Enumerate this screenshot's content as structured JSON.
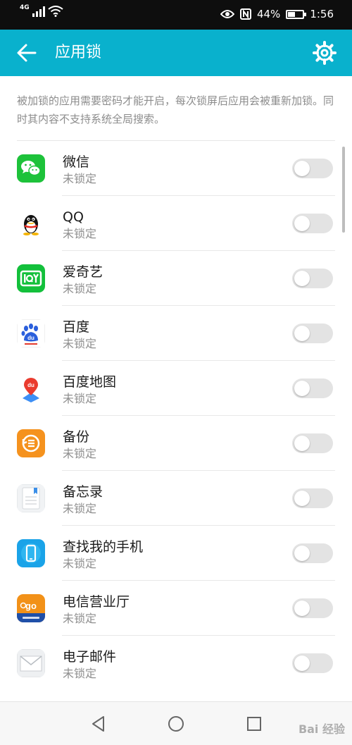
{
  "status_bar": {
    "network": "4G",
    "battery_percent": "44%",
    "time": "1:56",
    "icons": [
      "signal-icon",
      "wifi-icon",
      "eye-icon",
      "nfc-icon",
      "battery-icon"
    ]
  },
  "header": {
    "title": "应用锁",
    "back_icon": "arrow-left-icon",
    "settings_icon": "gear-icon"
  },
  "description": "被加锁的应用需要密码才能开启，每次锁屏后应用会被重新加锁。同时其内容不支持系统全局搜索。",
  "apps": [
    {
      "name": "微信",
      "status": "未锁定",
      "icon": "wechat-icon",
      "locked": false
    },
    {
      "name": "QQ",
      "status": "未锁定",
      "icon": "qq-icon",
      "locked": false
    },
    {
      "name": "爱奇艺",
      "status": "未锁定",
      "icon": "iqiyi-icon",
      "locked": false
    },
    {
      "name": "百度",
      "status": "未锁定",
      "icon": "baidu-icon",
      "locked": false
    },
    {
      "name": "百度地图",
      "status": "未锁定",
      "icon": "baidu-map-icon",
      "locked": false
    },
    {
      "name": "备份",
      "status": "未锁定",
      "icon": "backup-icon",
      "locked": false
    },
    {
      "name": "备忘录",
      "status": "未锁定",
      "icon": "notepad-icon",
      "locked": false
    },
    {
      "name": "查找我的手机",
      "status": "未锁定",
      "icon": "find-phone-icon",
      "locked": false
    },
    {
      "name": "电信营业厅",
      "status": "未锁定",
      "icon": "telecom-icon",
      "locked": false
    },
    {
      "name": "电子邮件",
      "status": "未锁定",
      "icon": "email-icon",
      "locked": false
    }
  ],
  "nav": {
    "back_icon": "triangle-back-icon",
    "home_icon": "circle-home-icon",
    "recent_icon": "square-recent-icon"
  },
  "watermark": "Bai 经验",
  "colors": {
    "accent": "#09b1cd",
    "status_bar": "#0e0e0e",
    "toggle_off": "#e3e3e3"
  }
}
